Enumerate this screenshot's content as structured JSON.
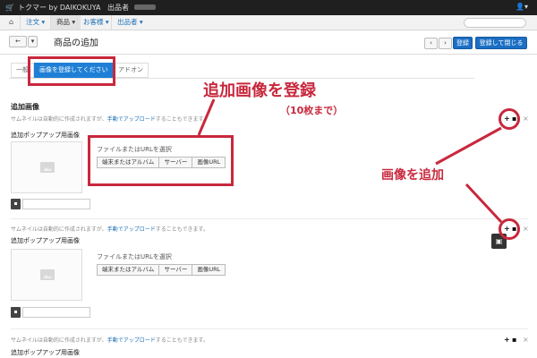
{
  "navbar": {
    "cart_icon": "cart-icon",
    "brand": "トクマー by DAIKOKUYA",
    "seller": "出品者",
    "user_icon": "user-icon"
  },
  "subnav": {
    "home_icon": "home-icon",
    "menus": [
      "注文 ▾",
      "商品 ▾",
      "お客様 ▾",
      "出品者 ▾"
    ],
    "active_menu": "商品 ▾"
  },
  "titlebar": {
    "back_label": "←",
    "dropdown_label": "▾",
    "title": "商品の追加",
    "prev_label": "‹",
    "next_label": "›",
    "register_label": "登録",
    "register_close_label": "登録して閉じる"
  },
  "tabs": {
    "general": "一般",
    "images_active": "画像を登録してください",
    "addons": "アドオン"
  },
  "annotations": {
    "register_images": "追加画像を登録",
    "max_count": "（10枚まで）",
    "add_image": "画像を追加"
  },
  "section": {
    "title": "追加画像",
    "hint_before": "サムネイルは自動的に作成されますが、",
    "hint_link": "手動でアップロード",
    "hint_after": "することもできます。",
    "popup_label": "追加ポップアップ用画像",
    "choose_label": "ファイルまたはURLを選択",
    "buttons": [
      "端末またはアルバム",
      "サーバー",
      "画像URL"
    ]
  },
  "controls": {
    "add": "+",
    "copy": "▪",
    "remove": "×"
  },
  "colors": {
    "accent_red": "#c8283d",
    "primary_blue": "#1b6fc4"
  }
}
